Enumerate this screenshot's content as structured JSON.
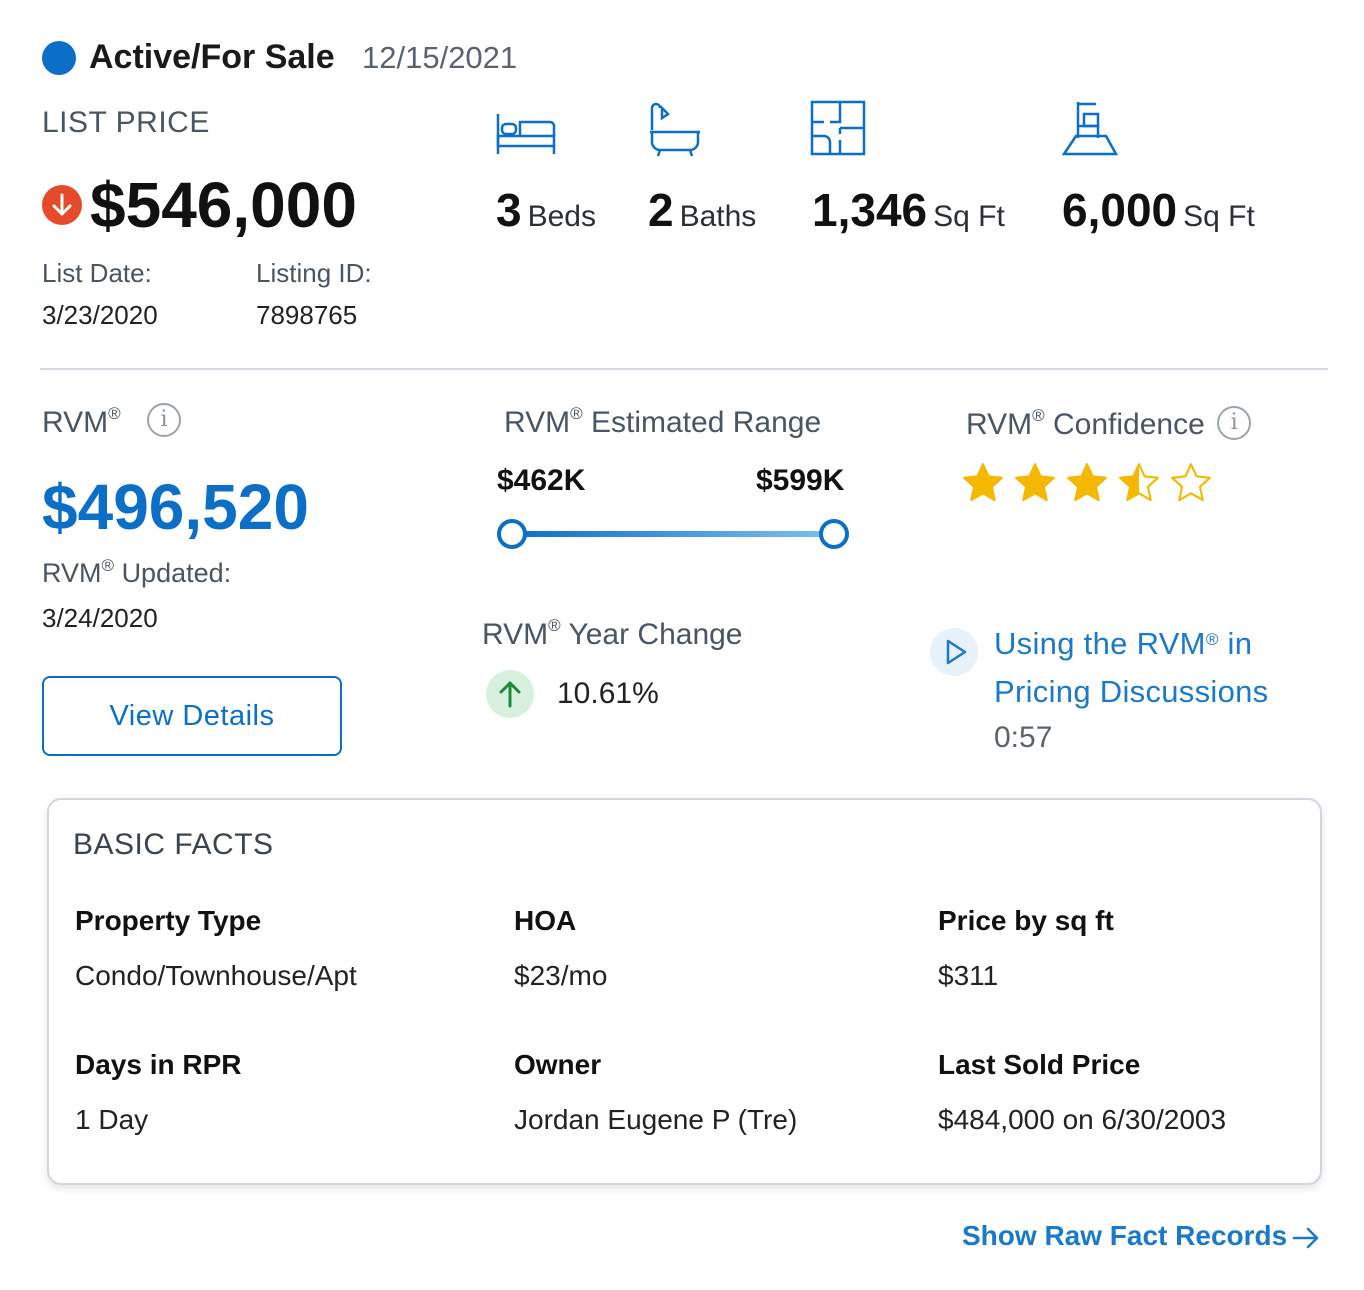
{
  "status": {
    "label": "Active/For Sale",
    "date": "12/15/2021",
    "dot_color": "#0b6fc7"
  },
  "list_price": {
    "label": "LIST PRICE",
    "value": "$546,000",
    "trend_icon": "arrow-down-icon",
    "list_date_label": "List Date:",
    "list_date": "3/23/2020",
    "listing_id_label": "Listing ID:",
    "listing_id": "7898765"
  },
  "stats": [
    {
      "icon": "bed-icon",
      "value": "3",
      "unit": "Beds"
    },
    {
      "icon": "bathtub-icon",
      "value": "2",
      "unit": "Baths"
    },
    {
      "icon": "floor-plan-icon",
      "value": "1,346",
      "unit": "Sq Ft"
    },
    {
      "icon": "lot-size-icon",
      "value": "6,000",
      "unit": "Sq Ft"
    }
  ],
  "rvm": {
    "name": "RVM",
    "reg": "®",
    "value": "$496,520",
    "updated_label": "Updated:",
    "updated_date": "3/24/2020",
    "view_details": "View Details",
    "range_title": "Estimated Range",
    "range_low": "$462K",
    "range_high": "$599K",
    "year_change_title": "Year Change",
    "year_change_value": "10.61%",
    "confidence_title": "Confidence",
    "confidence_stars": 3.5,
    "confidence_max": 5,
    "video_title_prefix": "Using the RVM",
    "video_title_suffix": " in Pricing Discussions",
    "video_duration": "0:57"
  },
  "basic_facts": {
    "title": "BASIC FACTS",
    "items": [
      {
        "label": "Property Type",
        "value": "Condo/Townhouse/Apt"
      },
      {
        "label": "HOA",
        "value": "$23/mo"
      },
      {
        "label": "Price by sq ft",
        "value": "$311"
      },
      {
        "label": "Days in RPR",
        "value": "1 Day"
      },
      {
        "label": "Owner",
        "value": "Jordan Eugene P (Tre)"
      },
      {
        "label": "Last Sold Price",
        "value": "$484,000 on 6/30/2003"
      }
    ]
  },
  "raw_link": "Show Raw Fact Records",
  "colors": {
    "brand_blue": "#0b6fc7",
    "link_blue": "#1a7ac9",
    "down_red": "#e64a2a",
    "up_green": "#1e8a3a",
    "star_gold": "#f5b800"
  }
}
